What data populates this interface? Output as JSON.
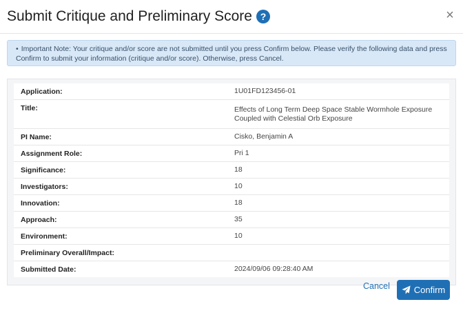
{
  "modal": {
    "title": "Submit Critique and Preliminary Score",
    "help_icon": "question-circle-icon",
    "close_icon": "close-icon",
    "close_symbol": "×"
  },
  "alert": {
    "bullet": "•",
    "text": "Important Note: Your critique and/or score are not submitted until you press Confirm below. Please verify the following data and press Confirm to submit your information (critique and/or score). Otherwise, press Cancel."
  },
  "details": {
    "rows": [
      {
        "label": "Application:",
        "value": "1U01FD123456-01"
      },
      {
        "label": "Title:",
        "value": "Effects of Long Term Deep Space Stable Wormhole Exposure Coupled with Celestial Orb Exposure"
      },
      {
        "label": "PI Name:",
        "value": "Cisko, Benjamin A"
      },
      {
        "label": "Assignment Role:",
        "value": "Pri 1"
      },
      {
        "label": "Significance:",
        "value": "18"
      },
      {
        "label": "Investigators:",
        "value": "10"
      },
      {
        "label": "Innovation:",
        "value": "18"
      },
      {
        "label": "Approach:",
        "value": "35"
      },
      {
        "label": "Environment:",
        "value": "10"
      },
      {
        "label": "Preliminary Overall/Impact:",
        "value": ""
      },
      {
        "label": "Submitted Date:",
        "value": "2024/09/06 09:28:40 AM"
      }
    ]
  },
  "footer": {
    "cancel_label": "Cancel",
    "confirm_label": "Confirm",
    "confirm_icon": "paper-plane-icon"
  },
  "colors": {
    "primary": "#1f6fb5",
    "alert_bg": "#d9e8f7"
  }
}
